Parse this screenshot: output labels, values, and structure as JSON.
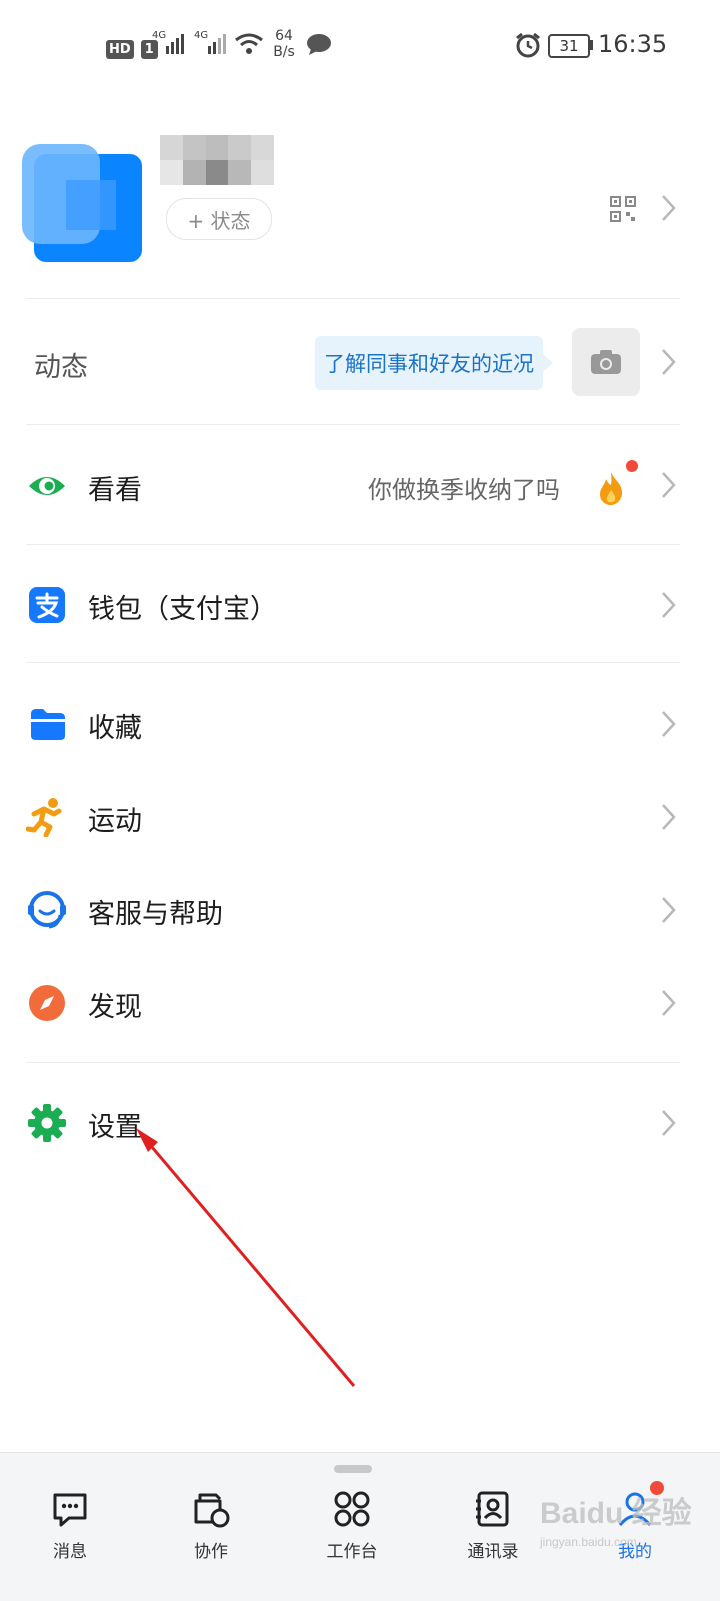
{
  "status_bar": {
    "hd": "HD",
    "sim": "1",
    "net1": "4G",
    "net2": "4G",
    "speed_value": "64",
    "speed_unit": "B/s",
    "battery": "31",
    "time": "16:35"
  },
  "profile": {
    "status_button": "+ 状态"
  },
  "rows": {
    "dongtai": {
      "label": "动态",
      "hint": "了解同事和好友的近况"
    },
    "kankan": {
      "label": "看看",
      "hint": "你做换季收纳了吗"
    },
    "wallet": {
      "label": "钱包（支付宝）"
    },
    "favorites": {
      "label": "收藏"
    },
    "sport": {
      "label": "运动"
    },
    "service": {
      "label": "客服与帮助"
    },
    "discover": {
      "label": "发现"
    },
    "settings": {
      "label": "设置"
    }
  },
  "tabbar": {
    "messages": "消息",
    "collab": "协作",
    "workbench": "工作台",
    "contacts": "通讯录",
    "mine": "我的"
  },
  "watermark": {
    "brand": "Baidu 经验",
    "url": "jingyan.baidu.com"
  },
  "colors": {
    "accent": "#1a73e8",
    "annotation_arrow": "#e02020",
    "settings_icon": "#1aad52",
    "wallet_icon": "#1677ff",
    "sport_icon": "#f39c12",
    "discover_icon": "#f26b3a"
  }
}
